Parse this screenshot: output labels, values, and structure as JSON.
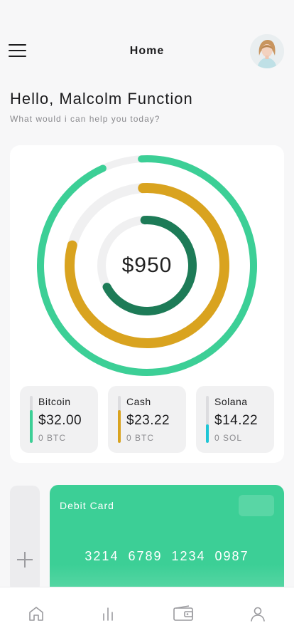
{
  "header": {
    "title": "Home",
    "menu_icon": "hamburger-menu-icon",
    "avatar_icon": "user-avatar"
  },
  "greeting": {
    "title": "Hello, Malcolm Function",
    "subtitle": "What would i can help you today?"
  },
  "balance": {
    "total": "$950",
    "colors": {
      "track": "#f0f0f1",
      "bitcoin": "#3ccf96",
      "cash": "#d9a31f",
      "solana": "#1d7b57"
    },
    "ring_fractions": {
      "outer": 0.94,
      "middle": 0.8,
      "inner": 0.68
    }
  },
  "assets": [
    {
      "name": "Bitcoin",
      "amount": "$32.00",
      "unit": "0 BTC",
      "color": "#3ccf96",
      "level": 0.7
    },
    {
      "name": "Cash",
      "amount": "$23.22",
      "unit": "0 BTC",
      "color": "#d9a31f",
      "level": 0.7
    },
    {
      "name": "Solana",
      "amount": "$14.22",
      "unit": "0 SOL",
      "color": "#1ec6d6",
      "level": 0.4
    }
  ],
  "cards": {
    "add_icon": "plus-icon",
    "debit": {
      "title": "Debit Card",
      "number": "3214 6789 1234 0987",
      "color": "#3ccf96"
    }
  },
  "nav": {
    "items": [
      {
        "icon": "home-icon"
      },
      {
        "icon": "stats-icon"
      },
      {
        "icon": "wallet-icon"
      },
      {
        "icon": "profile-icon"
      }
    ]
  }
}
